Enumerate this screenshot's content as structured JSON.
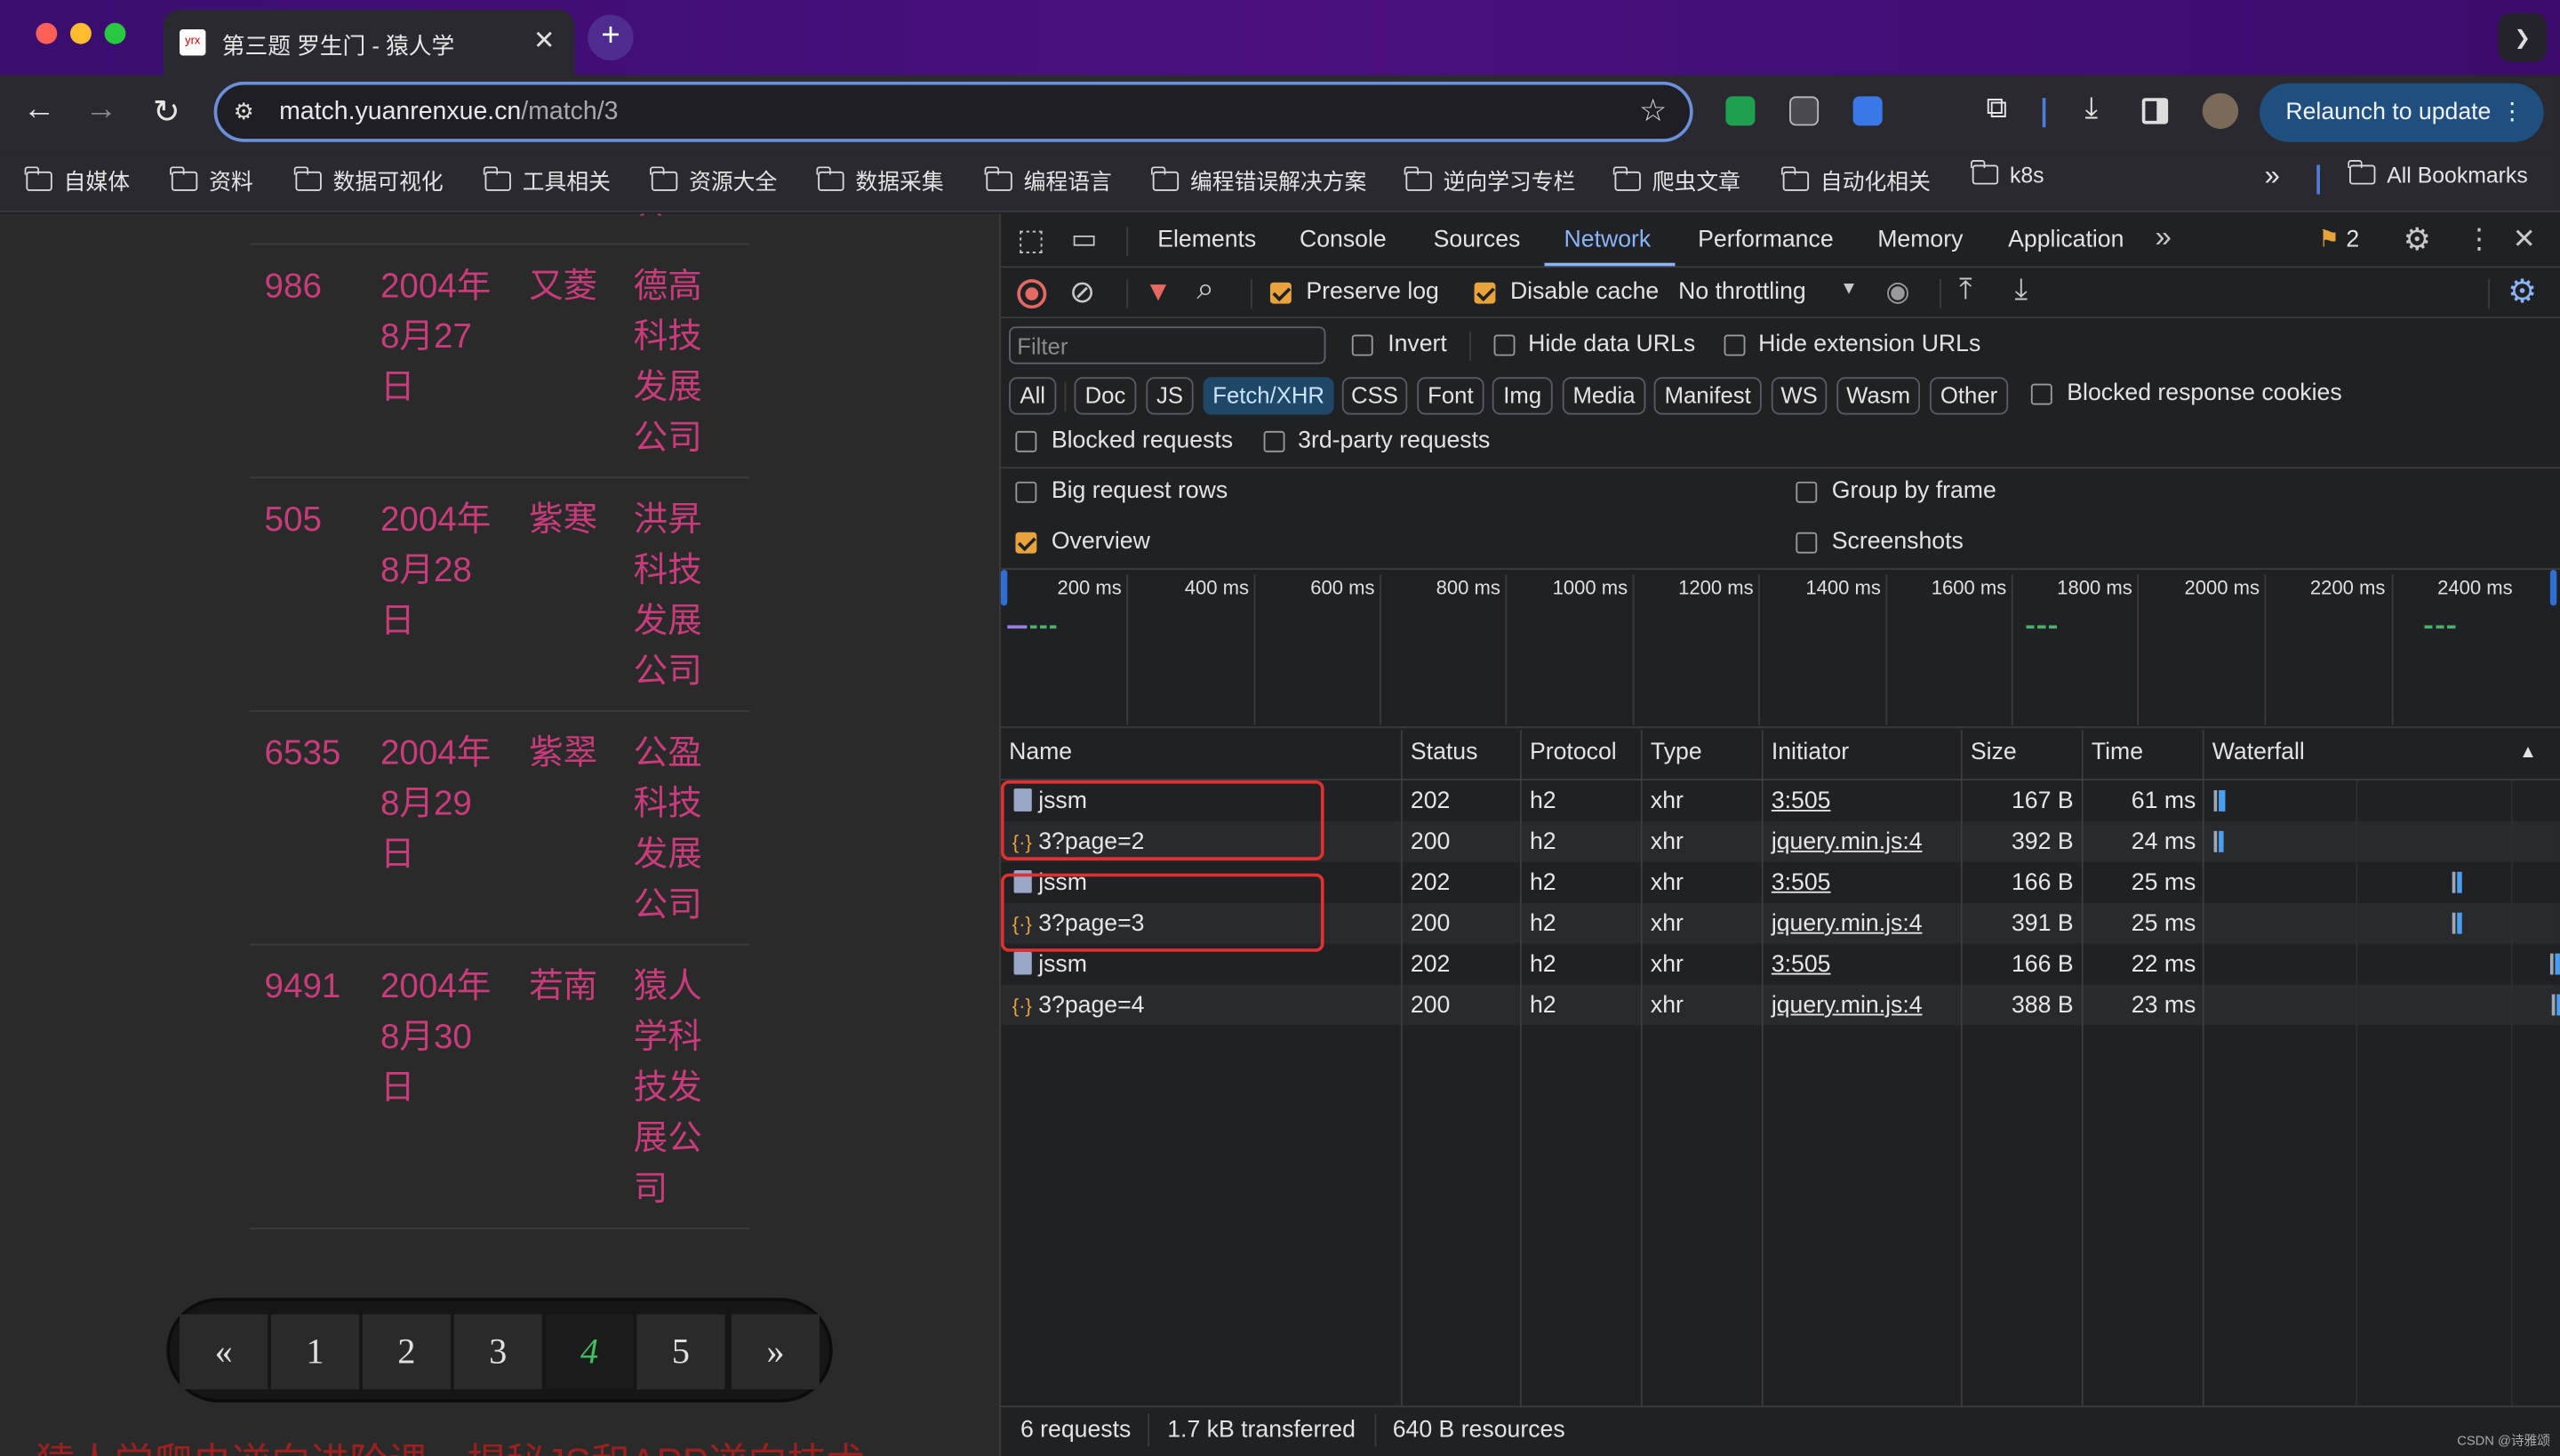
{
  "browser": {
    "tab_title": "第三题 罗生门 - 猿人学",
    "tab_favicon_text": "yrx",
    "url_host": "match.yuanrenxue.cn",
    "url_path": "/match/3",
    "relaunch_label": "Relaunch to update",
    "bookmarks": [
      "自媒体",
      "资料",
      "数据可视化",
      "工具相关",
      "资源大全",
      "数据采集",
      "编程语言",
      "编程错误解决方案",
      "逆向学习专栏",
      "爬虫文章",
      "自动化相关",
      "k8s"
    ],
    "all_bookmarks": "All Bookmarks",
    "overflow": "»"
  },
  "page": {
    "partial_top": "公",
    "rows": [
      {
        "num": "986",
        "date": [
          "2004年",
          "8月27",
          "日"
        ],
        "name": "又菱",
        "company": [
          "德高",
          "科技",
          "发展",
          "公司"
        ]
      },
      {
        "num": "505",
        "date": [
          "2004年",
          "8月28",
          "日"
        ],
        "name": "紫寒",
        "company": [
          "洪昇",
          "科技",
          "发展",
          "公司"
        ]
      },
      {
        "num": "6535",
        "date": [
          "2004年",
          "8月29",
          "日"
        ],
        "name": "紫翠",
        "company": [
          "公盈",
          "科技",
          "发展",
          "公司"
        ]
      },
      {
        "num": "9491",
        "date": [
          "2004年",
          "8月30",
          "日"
        ],
        "name": "若南",
        "company": [
          "猿人",
          "学科",
          "技发",
          "展公",
          "司"
        ]
      }
    ],
    "pager": {
      "prev": "«",
      "pages": [
        "1",
        "2",
        "3",
        "4",
        "5"
      ],
      "active": "4",
      "next": "»"
    },
    "footer_text": "猿人学爬虫逆向进阶课，揭秘JS和APP逆向技术"
  },
  "devtools": {
    "tabs": [
      "Elements",
      "Console",
      "Sources",
      "Network",
      "Performance",
      "Memory",
      "Application"
    ],
    "active_tab": "Network",
    "more": "»",
    "issues_count": "2",
    "toolbar": {
      "preserve_log": "Preserve log",
      "disable_cache": "Disable cache",
      "throttling": "No throttling"
    },
    "filter": {
      "placeholder": "Filter",
      "invert": "Invert",
      "hide_data_urls": "Hide data URLs",
      "hide_extension_urls": "Hide extension URLs",
      "types": [
        "All",
        "Doc",
        "JS",
        "Fetch/XHR",
        "CSS",
        "Font",
        "Img",
        "Media",
        "Manifest",
        "WS",
        "Wasm",
        "Other"
      ],
      "active_type": "Fetch/XHR",
      "blocked_response_cookies": "Blocked response cookies",
      "blocked_requests": "Blocked requests",
      "third_party": "3rd-party requests"
    },
    "settings": {
      "big_rows": "Big request rows",
      "group_by_frame": "Group by frame",
      "overview": "Overview",
      "screenshots": "Screenshots"
    },
    "timeline_ticks": [
      "200 ms",
      "400 ms",
      "600 ms",
      "800 ms",
      "1000 ms",
      "1200 ms",
      "1400 ms",
      "1600 ms",
      "1800 ms",
      "2000 ms",
      "2200 ms",
      "2400 ms"
    ],
    "columns": [
      "Name",
      "Status",
      "Protocol",
      "Type",
      "Initiator",
      "Size",
      "Time",
      "Waterfall"
    ],
    "sort_indicator": "▲",
    "requests": [
      {
        "name": "jssm",
        "kind": "doc",
        "status": "202",
        "protocol": "h2",
        "type": "xhr",
        "initiator": "3:505",
        "size": "167 B",
        "time": "61 ms",
        "wf": 0.012
      },
      {
        "name": "3?page=2",
        "kind": "xhr",
        "status": "200",
        "protocol": "h2",
        "type": "xhr",
        "initiator": "jquery.min.js:4",
        "size": "392 B",
        "time": "24 ms",
        "wf": 0.012
      },
      {
        "name": "jssm",
        "kind": "doc",
        "status": "202",
        "protocol": "h2",
        "type": "xhr",
        "initiator": "3:505",
        "size": "166 B",
        "time": "25 ms",
        "wf": 0.7
      },
      {
        "name": "3?page=3",
        "kind": "xhr",
        "status": "200",
        "protocol": "h2",
        "type": "xhr",
        "initiator": "jquery.min.js:4",
        "size": "391 B",
        "time": "25 ms",
        "wf": 0.7
      },
      {
        "name": "jssm",
        "kind": "doc",
        "status": "202",
        "protocol": "h2",
        "type": "xhr",
        "initiator": "3:505",
        "size": "166 B",
        "time": "22 ms",
        "wf": 0.98
      },
      {
        "name": "3?page=4",
        "kind": "xhr",
        "status": "200",
        "protocol": "h2",
        "type": "xhr",
        "initiator": "jquery.min.js:4",
        "size": "388 B",
        "time": "23 ms",
        "wf": 0.985
      }
    ],
    "status_bar": {
      "requests": "6 requests",
      "transferred": "1.7 kB transferred",
      "resources": "640 B resources"
    },
    "watermark": "CSDN @诗雅颂"
  },
  "colors": {
    "accent": "#8ab4f8",
    "page_text": "#c83c7c",
    "highlight_box": "#e03030",
    "active_page": "#3fbf5f"
  }
}
